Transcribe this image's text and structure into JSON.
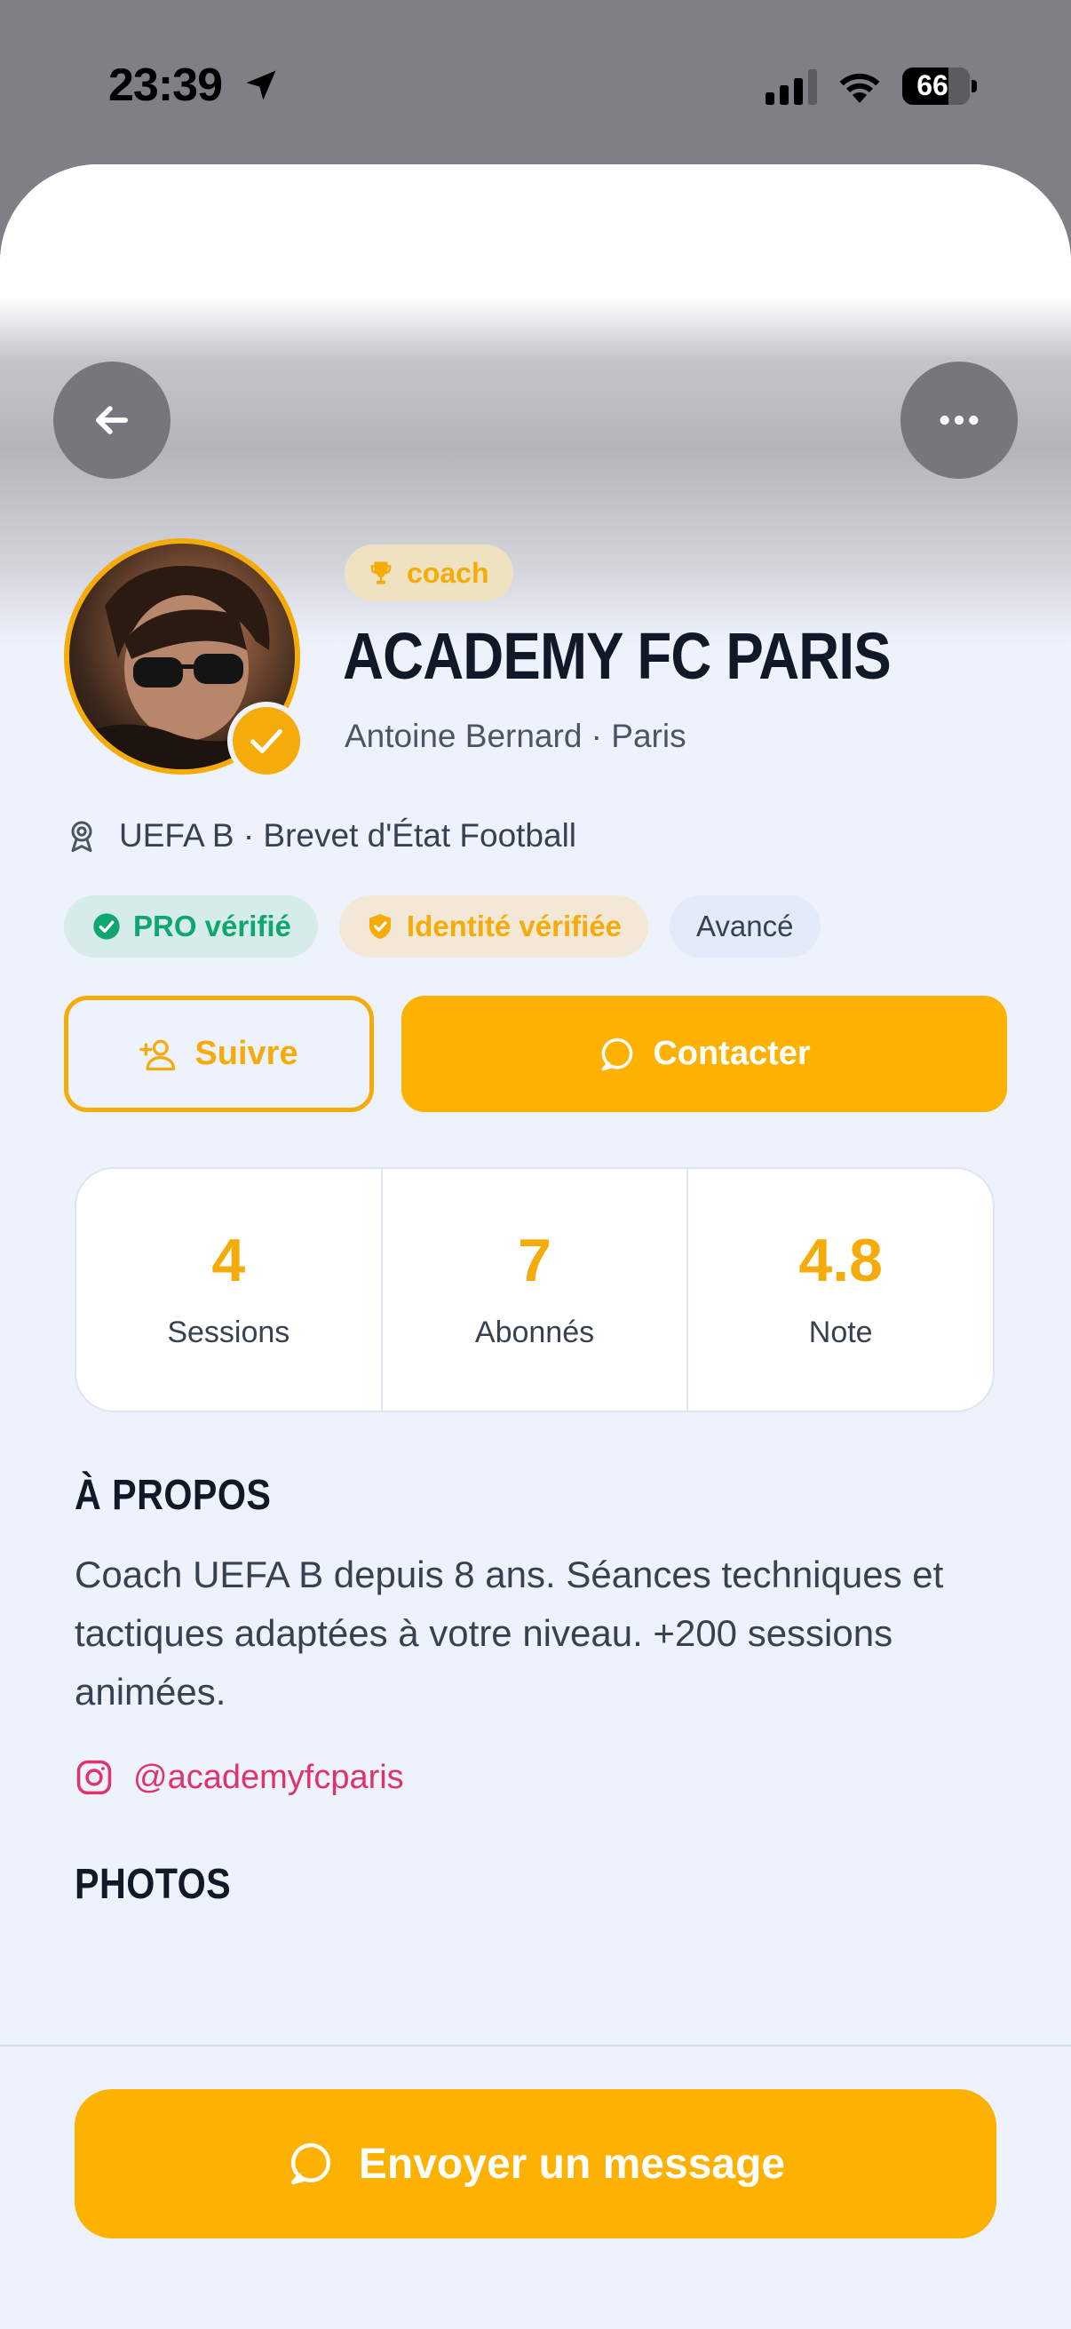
{
  "status_bar": {
    "time": "23:39",
    "battery": "66"
  },
  "profile": {
    "role": "coach",
    "name": "ACADEMY FC PARIS",
    "subtitle": "Antoine Bernard · Paris",
    "certification": "UEFA B · Brevet d'État Football",
    "badges": {
      "pro": "PRO vérifié",
      "identity": "Identité vérifiée",
      "level": "Avancé"
    }
  },
  "actions": {
    "follow": "Suivre",
    "contact": "Contacter"
  },
  "stats": [
    {
      "value": "4",
      "label": "Sessions"
    },
    {
      "value": "7",
      "label": "Abonnés"
    },
    {
      "value": "4.8",
      "label": "Note"
    }
  ],
  "about": {
    "title": "À PROPOS",
    "text": "Coach UEFA B depuis 8 ans. Séances techniques et tactiques adaptées à votre niveau. +200 sessions animées.",
    "instagram": "@academyfcparis"
  },
  "photos": {
    "title": "PHOTOS"
  },
  "footer": {
    "send_message": "Envoyer un message"
  },
  "colors": {
    "accent": "#fdb100",
    "verified_green": "#10a670",
    "instagram": "#e0336b",
    "background": "#eef2fc"
  }
}
